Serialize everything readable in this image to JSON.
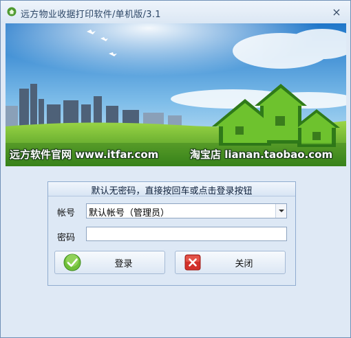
{
  "window": {
    "title": "远方物业收据打印软件/单机版/3.1",
    "close_icon": "close-icon"
  },
  "banner": {
    "left_text": "远方软件官网 www.itfar.com",
    "right_text": "淘宝店 lianan.taobao.com"
  },
  "login": {
    "header": "默认无密码，直接按回车或点击登录按钮",
    "account_label": "帐号",
    "account_value": "默认帐号（管理员）",
    "password_label": "密码",
    "password_value": "",
    "login_button": "登录",
    "close_button": "关闭"
  },
  "colors": {
    "title_text": "#2c4666",
    "panel_border": "#8fabcf",
    "login_icon": "#4a9a2a",
    "close_icon": "#d2302a"
  }
}
